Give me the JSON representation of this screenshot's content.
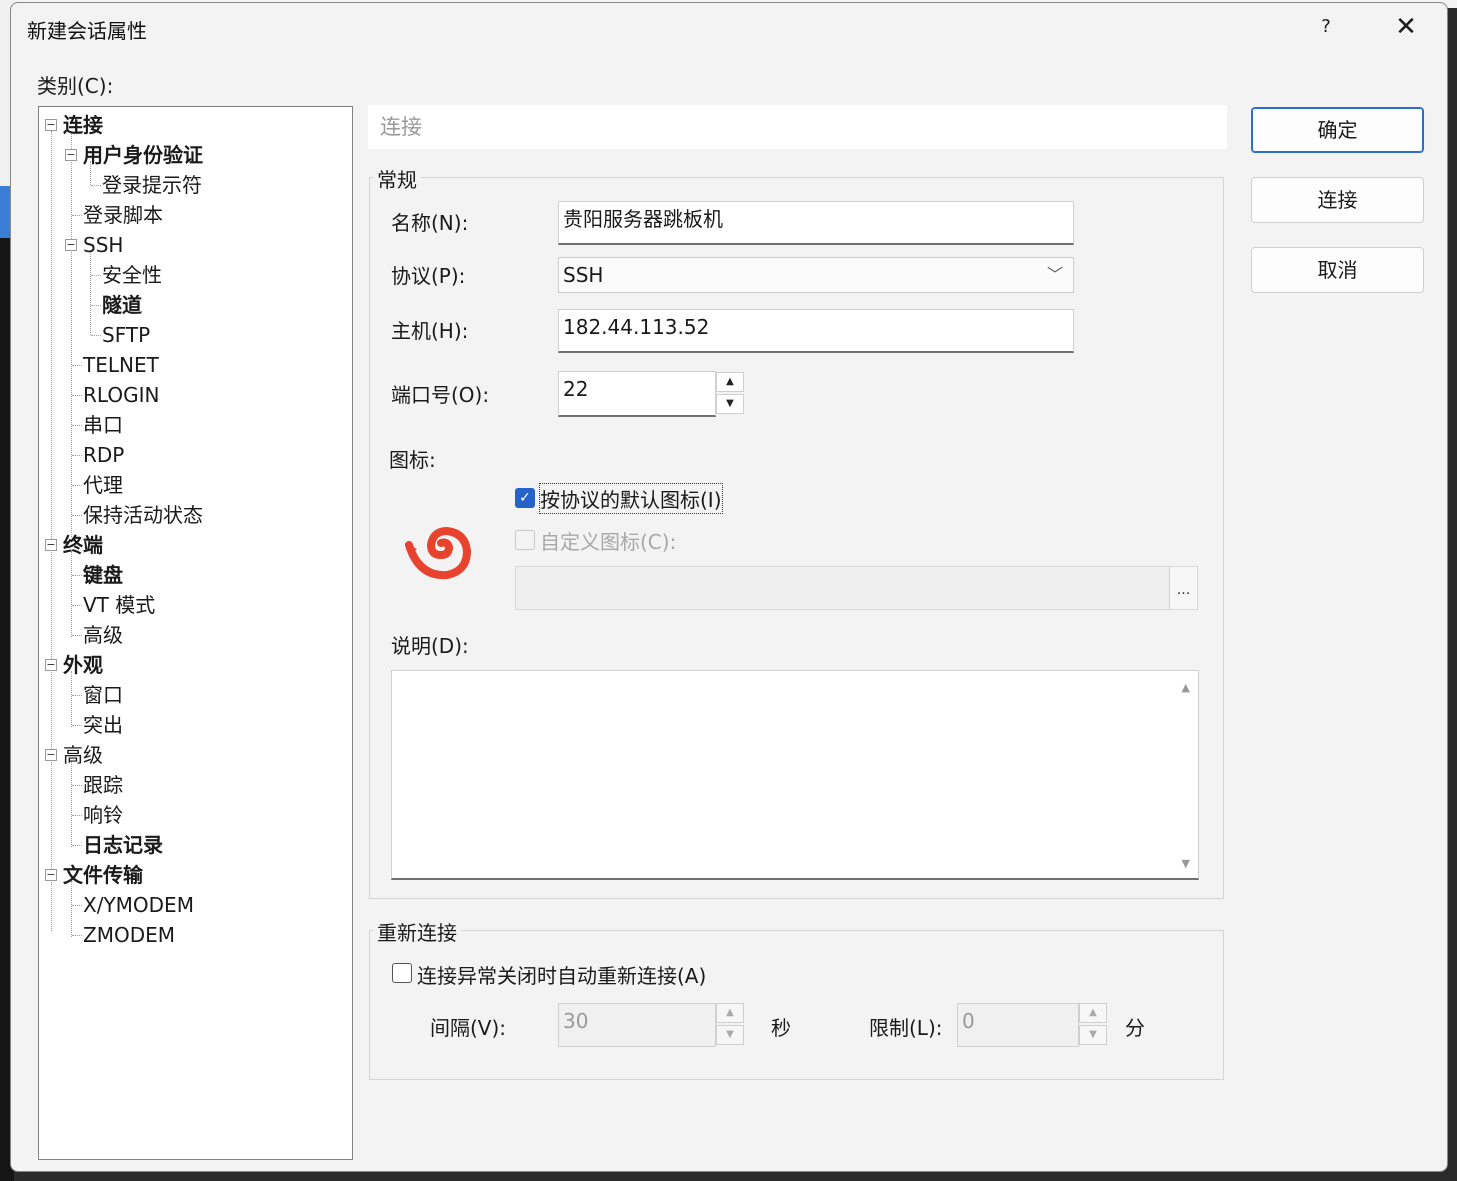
{
  "dialog": {
    "title": "新建会话属性",
    "help_label": "?",
    "close_label": "✕"
  },
  "category_label": "类别(C):",
  "tree": [
    {
      "label": "连接",
      "bold": true
    },
    {
      "label": "用户身份验证",
      "bold": true
    },
    {
      "label": "登录提示符",
      "bold": false
    },
    {
      "label": "登录脚本",
      "bold": false
    },
    {
      "label": "SSH",
      "bold": false
    },
    {
      "label": "安全性",
      "bold": false
    },
    {
      "label": "隧道",
      "bold": true
    },
    {
      "label": "SFTP",
      "bold": false
    },
    {
      "label": "TELNET",
      "bold": false
    },
    {
      "label": "RLOGIN",
      "bold": false
    },
    {
      "label": "串口",
      "bold": false
    },
    {
      "label": "RDP",
      "bold": false
    },
    {
      "label": "代理",
      "bold": false
    },
    {
      "label": "保持活动状态",
      "bold": false
    },
    {
      "label": "终端",
      "bold": true
    },
    {
      "label": "键盘",
      "bold": true
    },
    {
      "label": "VT 模式",
      "bold": false
    },
    {
      "label": "高级",
      "bold": false
    },
    {
      "label": "外观",
      "bold": true
    },
    {
      "label": "窗口",
      "bold": false
    },
    {
      "label": "突出",
      "bold": false
    },
    {
      "label": "高级",
      "bold": false
    },
    {
      "label": "跟踪",
      "bold": false
    },
    {
      "label": "响铃",
      "bold": false
    },
    {
      "label": "日志记录",
      "bold": true
    },
    {
      "label": "文件传输",
      "bold": true
    },
    {
      "label": "X/YMODEM",
      "bold": false
    },
    {
      "label": "ZMODEM",
      "bold": false
    }
  ],
  "section_title": "连接",
  "general": {
    "group_label": "常规",
    "name_label": "名称(N):",
    "name_value": "贵阳服务器跳板机",
    "protocol_label": "协议(P):",
    "protocol_value": "SSH",
    "host_label": "主机(H):",
    "host_value": "182.44.113.52",
    "port_label": "端口号(O):",
    "port_value": "22",
    "icon_label": "图标:",
    "default_icon_label": "按协议的默认图标(I)",
    "default_icon_checked": true,
    "custom_icon_label": "自定义图标(C):",
    "custom_icon_checked": false,
    "browse_label": "...",
    "description_label": "说明(D):",
    "description_value": ""
  },
  "reconnect": {
    "group_label": "重新连接",
    "auto_label": "连接异常关闭时自动重新连接(A)",
    "auto_checked": false,
    "interval_label": "间隔(V):",
    "interval_value": "30",
    "interval_unit": "秒",
    "limit_label": "限制(L):",
    "limit_value": "0",
    "limit_unit": "分"
  },
  "buttons": {
    "ok": "确定",
    "connect": "连接",
    "cancel": "取消"
  },
  "colors": {
    "accent": "#2563c9",
    "icon_red": "#e8432e"
  }
}
